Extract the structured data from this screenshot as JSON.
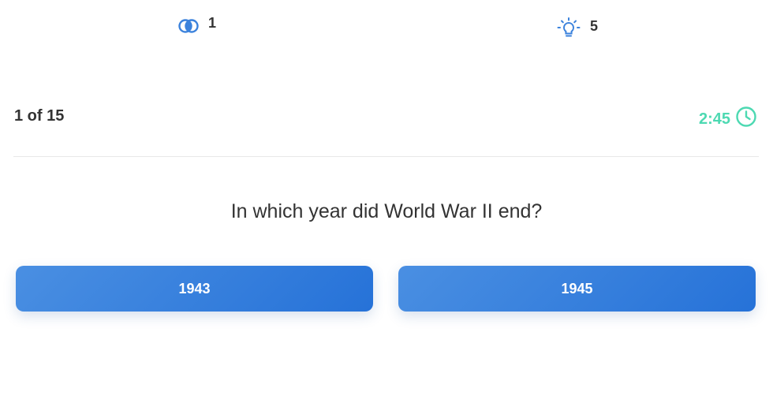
{
  "stats": {
    "lifeline": {
      "icon": "double-circle-icon",
      "value": "1"
    },
    "hint": {
      "icon": "lightbulb-icon",
      "value": "5"
    }
  },
  "progress": {
    "label": "1 of 15"
  },
  "timer": {
    "value": "2:45",
    "icon": "clock-icon"
  },
  "question": {
    "text": "In which year did World War II end?"
  },
  "answers": [
    {
      "label": "1943"
    },
    {
      "label": "1945"
    }
  ],
  "colors": {
    "accent_blue": "#2672d8",
    "timer_green": "#4dd9b2",
    "text": "#333333"
  }
}
